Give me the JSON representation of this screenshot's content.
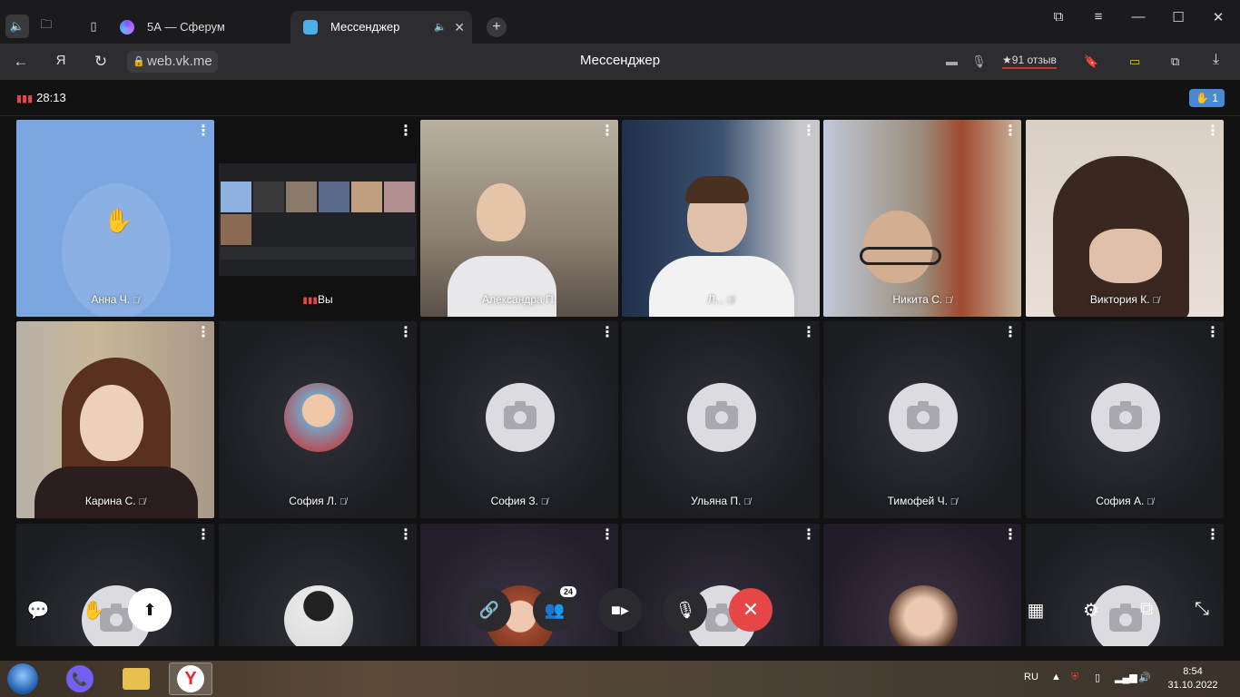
{
  "browser": {
    "tabs": [
      {
        "label": "5А — Сферум"
      },
      {
        "label": "Мессенджер"
      }
    ],
    "url": "web.vk.me",
    "page_title": "Мессенджер",
    "reviews": "91 отзыв"
  },
  "call": {
    "duration": "28:13",
    "raised_hands": "1",
    "participants_count": "24"
  },
  "tiles": [
    {
      "name": "Анна Ч."
    },
    {
      "name": "Вы"
    },
    {
      "name": "Александра П."
    },
    {
      "name": "Л..."
    },
    {
      "name": "Никита С."
    },
    {
      "name": "Виктория К."
    },
    {
      "name": "Карина С."
    },
    {
      "name": "София Л."
    },
    {
      "name": "София З."
    },
    {
      "name": "Ульяна П."
    },
    {
      "name": "Тимофей Ч."
    },
    {
      "name": "София А."
    }
  ],
  "taskbar": {
    "language": "RU",
    "time": "8:54",
    "date": "31.10.2022"
  },
  "colors": {
    "accent_blue": "#4a8ad4",
    "end_call_red": "#e64646",
    "raised_hand_tile": "#7ba6e0"
  }
}
